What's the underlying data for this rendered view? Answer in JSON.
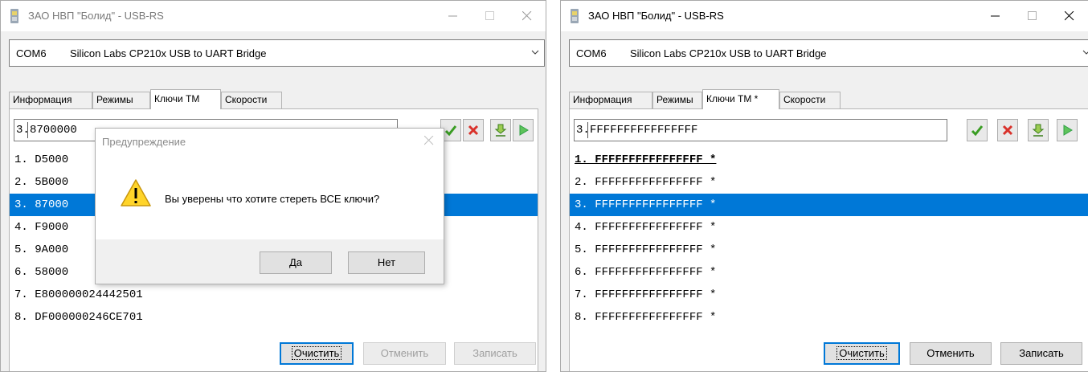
{
  "window_left": {
    "title": "ЗАО НВП \"Болид\" - USB-RS",
    "combo": {
      "port": "COM6",
      "description": "Silicon Labs CP210x USB to UART Bridge"
    },
    "tabs": [
      "Информация",
      "Режимы",
      "Ключи ТМ",
      "Скорости"
    ],
    "input": {
      "prefix": "3.",
      "value": "8700000"
    },
    "keys": [
      "1. D5000",
      "2. 5B000",
      "3. 87000",
      "4. F9000",
      "5. 9A000",
      "6. 58000",
      "7. E800000024442501",
      "8. DF000000246CE701"
    ],
    "buttons": {
      "clear": "Очистить",
      "cancel": "Отменить",
      "write": "Записать"
    },
    "dialog": {
      "title": "Предупреждение",
      "message": "Вы уверены что хотите стереть ВСЕ ключи?",
      "yes": "Да",
      "no": "Нет"
    }
  },
  "window_right": {
    "title": "ЗАО НВП \"Болид\" - USB-RS",
    "combo": {
      "port": "COM6",
      "description": "Silicon Labs CP210x USB to UART Bridge"
    },
    "tabs": [
      "Информация",
      "Режимы",
      "Ключи ТМ *",
      "Скорости"
    ],
    "input": {
      "prefix": "3.",
      "value": "FFFFFFFFFFFFFFFF"
    },
    "keys": [
      "1. FFFFFFFFFFFFFFFF *",
      "2. FFFFFFFFFFFFFFFF *",
      "3. FFFFFFFFFFFFFFFF *",
      "4. FFFFFFFFFFFFFFFF *",
      "5. FFFFFFFFFFFFFFFF *",
      "6. FFFFFFFFFFFFFFFF *",
      "7. FFFFFFFFFFFFFFFF *",
      "8. FFFFFFFFFFFFFFFF *"
    ],
    "buttons": {
      "clear": "Очистить",
      "cancel": "Отменить",
      "write": "Записать"
    }
  },
  "colors": {
    "selection": "#0078d7",
    "apply": "#3a9d23",
    "delete": "#d9322b",
    "play": "#2ea043"
  },
  "icons": [
    "checkmark-icon",
    "delete-x-icon",
    "download-icon",
    "play-icon",
    "warning-icon"
  ]
}
